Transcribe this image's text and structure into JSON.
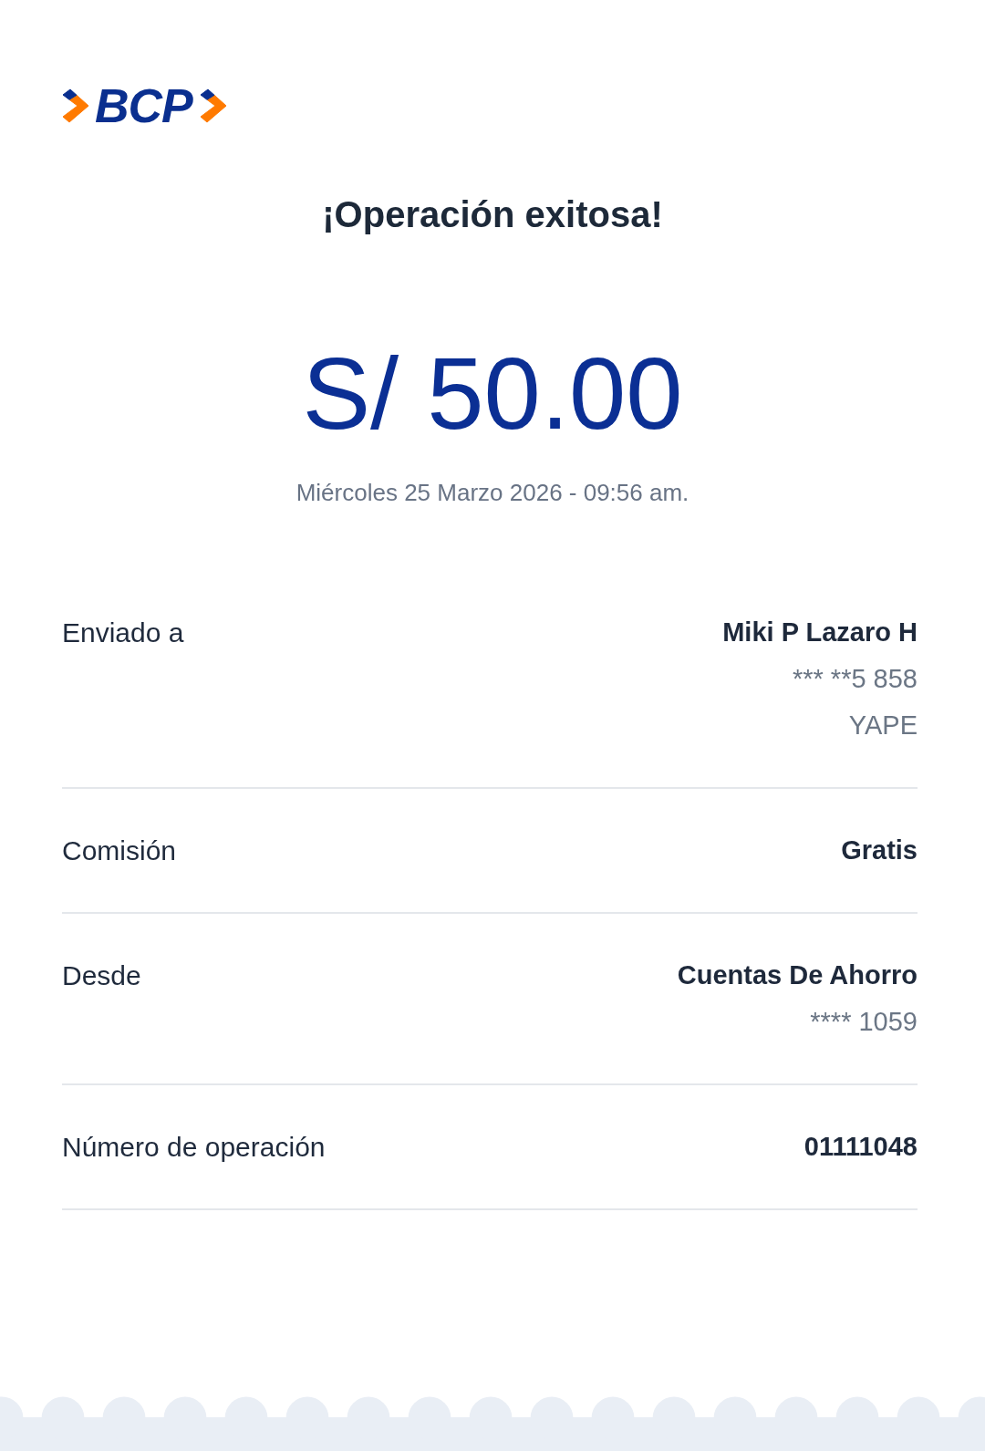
{
  "logo": {
    "text": "BCP"
  },
  "title": "¡Operación exitosa!",
  "amount": "S/ 50.00",
  "datetime": "Miércoles 25 Marzo 2026 - 09:56 am.",
  "details": [
    {
      "label": "Enviado a",
      "value": "Miki P Lazaro H",
      "notes": [
        "*** **5 858",
        "YAPE"
      ]
    },
    {
      "label": "Comisión",
      "value": "Gratis"
    },
    {
      "label": "Desde",
      "value": "Cuentas De Ahorro",
      "notes": [
        "**** 1059"
      ]
    },
    {
      "label": "Número de operación",
      "value": "01111048"
    }
  ]
}
